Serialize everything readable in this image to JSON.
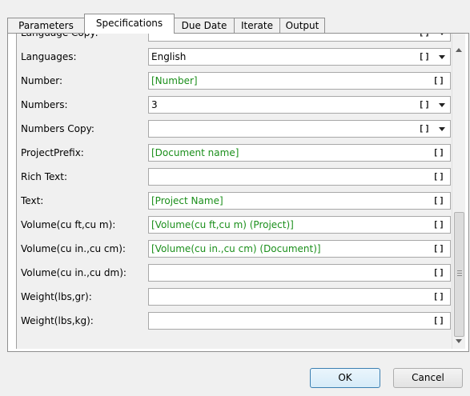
{
  "tabs": [
    {
      "label": "Parameters"
    },
    {
      "label": "Specifications"
    },
    {
      "label": "Due Date"
    },
    {
      "label": "Iterate"
    },
    {
      "label": "Output"
    }
  ],
  "active_tab": "Specifications",
  "rows": [
    {
      "label": "Language Copy:",
      "value": "",
      "template": false,
      "dropdown": true
    },
    {
      "label": "Languages:",
      "value": "English",
      "template": false,
      "dropdown": true
    },
    {
      "label": "Number:",
      "value": "[Number]",
      "template": true,
      "dropdown": false
    },
    {
      "label": "Numbers:",
      "value": "3",
      "template": false,
      "dropdown": true
    },
    {
      "label": "Numbers Copy:",
      "value": "",
      "template": false,
      "dropdown": true
    },
    {
      "label": "ProjectPrefix:",
      "value": "[Document name]",
      "template": true,
      "dropdown": false
    },
    {
      "label": "Rich Text:",
      "value": "",
      "template": false,
      "dropdown": false
    },
    {
      "label": "Text:",
      "value": "[Project Name]",
      "template": true,
      "dropdown": false
    },
    {
      "label": "Volume(cu ft,cu m):",
      "value": "[Volume(cu ft,cu m) (Project)]",
      "template": true,
      "dropdown": false
    },
    {
      "label": "Volume(cu in.,cu cm):",
      "value": "[Volume(cu in.,cu cm) (Document)]",
      "template": true,
      "dropdown": false
    },
    {
      "label": "Volume(cu in.,cu dm):",
      "value": "",
      "template": false,
      "dropdown": false
    },
    {
      "label": "Weight(lbs,gr):",
      "value": "",
      "template": false,
      "dropdown": false
    },
    {
      "label": "Weight(lbs,kg):",
      "value": "",
      "template": false,
      "dropdown": false
    }
  ],
  "bracket_glyph": "[]",
  "buttons": {
    "ok": "OK",
    "cancel": "Cancel"
  },
  "colors": {
    "template_value": "#1b8f1b",
    "panel_bg": "#f0f0f0",
    "field_bg": "#ffffff"
  }
}
